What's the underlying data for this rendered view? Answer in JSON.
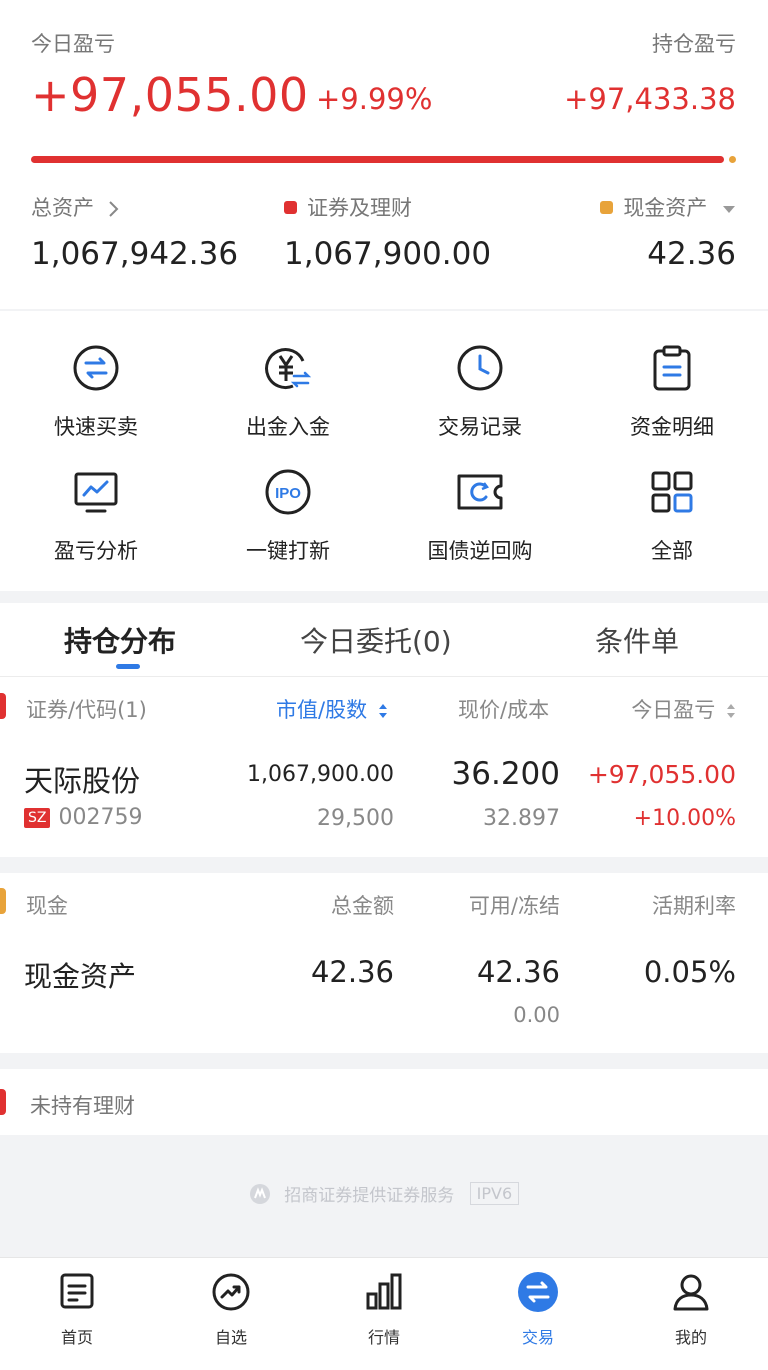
{
  "summary": {
    "today_pl_label": "今日盈亏",
    "today_pl_value": "+97,055.00",
    "today_pl_pct": "+9.99%",
    "holding_pl_label": "持仓盈亏",
    "holding_pl_value": "+97,433.38",
    "total_assets_label": "总资产",
    "total_assets_value": "1,067,942.36",
    "securities_label": "证券及理财",
    "securities_value": "1,067,900.00",
    "cash_label": "现金资产",
    "cash_value": "42.36",
    "allocation_securities_fraction": 0.99996
  },
  "quick_actions": [
    {
      "label": "快速买卖",
      "icon": "swap-circle-icon"
    },
    {
      "label": "出金入金",
      "icon": "yuan-transfer-icon"
    },
    {
      "label": "交易记录",
      "icon": "clock-icon"
    },
    {
      "label": "资金明细",
      "icon": "clipboard-icon"
    },
    {
      "label": "盈亏分析",
      "icon": "chart-monitor-icon"
    },
    {
      "label": "一键打新",
      "icon": "ipo-icon"
    },
    {
      "label": "国债逆回购",
      "icon": "ticket-cycle-icon"
    },
    {
      "label": "全部",
      "icon": "grid-icon"
    }
  ],
  "tabs": [
    {
      "label": "持仓分布",
      "active": true
    },
    {
      "label": "今日委托(0)",
      "active": false
    },
    {
      "label": "条件单",
      "active": false
    }
  ],
  "holdings": {
    "headers": {
      "security": "证券/代码(1)",
      "market_value": "市值/股数",
      "price_cost": "现价/成本",
      "today_pl": "今日盈亏"
    },
    "rows": [
      {
        "name": "天际股份",
        "market": "SZ",
        "code": "002759",
        "market_value": "1,067,900.00",
        "shares": "29,500",
        "price": "36.200",
        "cost": "32.897",
        "today_pl": "+97,055.00",
        "today_pl_pct": "+10.00%"
      }
    ]
  },
  "cash": {
    "headers": {
      "title": "现金",
      "total": "总金额",
      "available_frozen": "可用/冻结",
      "rate": "活期利率"
    },
    "row": {
      "name": "现金资产",
      "total": "42.36",
      "available": "42.36",
      "frozen": "0.00",
      "rate": "0.05%"
    }
  },
  "wealth": {
    "title": "未持有理财"
  },
  "footer": {
    "service_text": "招商证券提供证券服务",
    "ipv6_badge": "IPV6"
  },
  "nav": [
    {
      "label": "首页",
      "icon": "home-doc-icon",
      "active": false
    },
    {
      "label": "自选",
      "icon": "trend-circle-icon",
      "active": false
    },
    {
      "label": "行情",
      "icon": "bar-chart-icon",
      "active": false
    },
    {
      "label": "交易",
      "icon": "trade-swap-icon",
      "active": true
    },
    {
      "label": "我的",
      "icon": "user-icon",
      "active": false
    }
  ],
  "colors": {
    "up_red": "#e03131",
    "accent_blue": "#2f7ae5",
    "cash_yellow": "#e8a33a"
  }
}
